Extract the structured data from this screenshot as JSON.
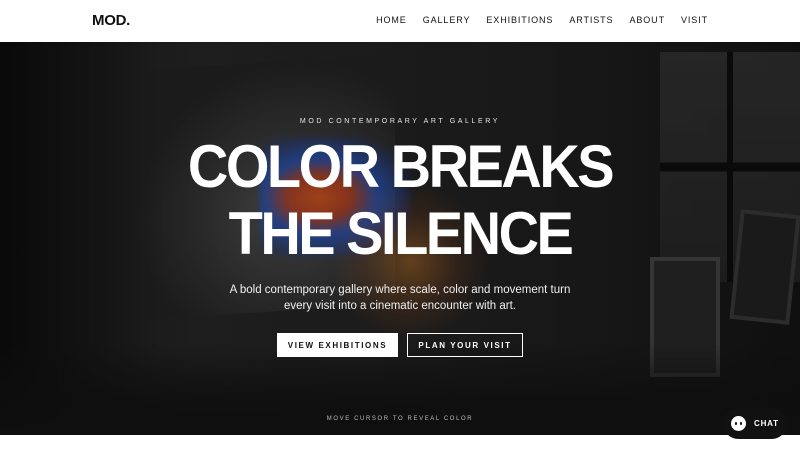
{
  "brand": {
    "logo": "MOD."
  },
  "nav": {
    "items": [
      {
        "label": "HOME"
      },
      {
        "label": "GALLERY"
      },
      {
        "label": "EXHIBITIONS"
      },
      {
        "label": "ARTISTS"
      },
      {
        "label": "ABOUT"
      },
      {
        "label": "VISIT"
      }
    ]
  },
  "hero": {
    "eyebrow": "MOD CONTEMPORARY ART GALLERY",
    "headline_line1": "COLOR BREAKS",
    "headline_line2": "THE SILENCE",
    "subtext_line1": "A bold contemporary gallery where scale, color and movement turn",
    "subtext_line2": "every visit into a cinematic encounter with art.",
    "primary_button": "VIEW EXHIBITIONS",
    "secondary_button": "PLAN YOUR VISIT",
    "hint": "MOVE CURSOR TO REVEAL COLOR"
  },
  "chat": {
    "label": "CHAT",
    "icon": "chat-bubble-icon"
  },
  "colors": {
    "nav_bg": "#ffffff",
    "text_dark": "#111111",
    "hero_text": "#ffffff",
    "paint_orange": "#e65c23",
    "paint_blue": "#285ac8"
  }
}
